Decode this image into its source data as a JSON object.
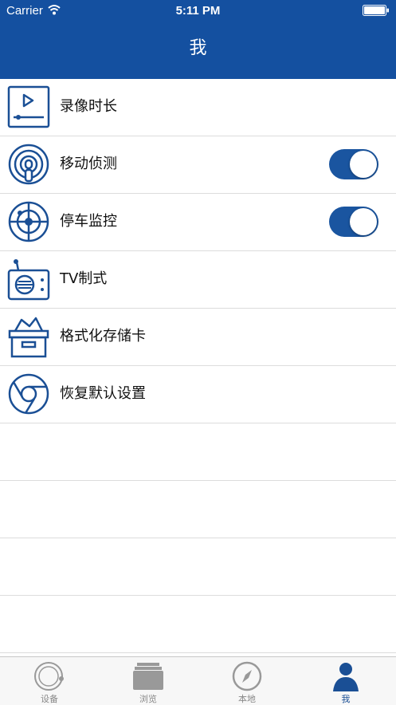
{
  "status_bar": {
    "carrier": "Carrier",
    "time": "5:11 PM"
  },
  "header": {
    "title": "我"
  },
  "settings": {
    "items": [
      {
        "label": "录像时长",
        "icon": "video-icon",
        "has_toggle": false
      },
      {
        "label": "移动侦测",
        "icon": "motion-sensor-icon",
        "has_toggle": true,
        "toggle_on": true
      },
      {
        "label": "停车监控",
        "icon": "radar-icon",
        "has_toggle": true,
        "toggle_on": true
      },
      {
        "label": "TV制式",
        "icon": "tv-radio-icon",
        "has_toggle": false
      },
      {
        "label": "格式化存储卡",
        "icon": "storage-box-icon",
        "has_toggle": false
      },
      {
        "label": "恢复默认设置",
        "icon": "chrome-reset-icon",
        "has_toggle": false
      }
    ]
  },
  "tabbar": {
    "tabs": [
      {
        "label": "设备",
        "icon": "device-icon",
        "active": false
      },
      {
        "label": "浏览",
        "icon": "browse-icon",
        "active": false
      },
      {
        "label": "本地",
        "icon": "compass-icon",
        "active": false
      },
      {
        "label": "我",
        "icon": "person-icon",
        "active": true
      }
    ]
  },
  "colors": {
    "accent": "#1450a0",
    "toggle_on": "#1a55a0",
    "icon_stroke": "#1a4f95",
    "tab_inactive": "#888888"
  }
}
